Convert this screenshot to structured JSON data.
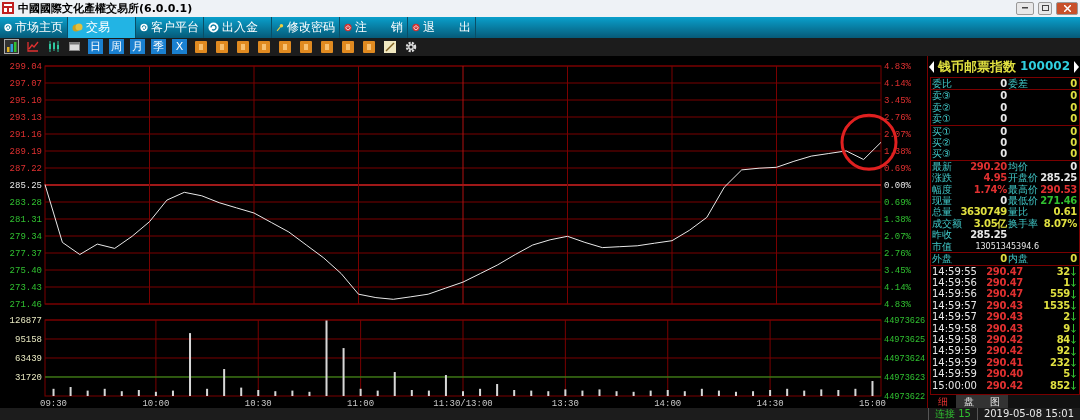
{
  "window": {
    "title": "中國國際文化產權交易所(6.0.0.1)"
  },
  "nav": {
    "items": [
      {
        "label": "市场主页",
        "kind": "refresh",
        "selected": false
      },
      {
        "label": "交易",
        "kind": "trade",
        "selected": true
      },
      {
        "label": "客户平台",
        "kind": "refresh",
        "selected": false
      },
      {
        "label": "出入金",
        "kind": "refresh",
        "selected": false
      },
      {
        "label": "修改密码",
        "kind": "key",
        "selected": false
      },
      {
        "label": "注　　销",
        "kind": "power",
        "selected": false
      },
      {
        "label": "退　　出",
        "kind": "power",
        "selected": false
      }
    ]
  },
  "toolbar": {
    "items": [
      {
        "kind": "bars",
        "selected": true
      },
      {
        "kind": "line",
        "selected": false
      },
      {
        "kind": "candle",
        "selected": false
      },
      {
        "kind": "window",
        "selected": false
      },
      {
        "kind": "period",
        "label": "日",
        "selected": false
      },
      {
        "kind": "period",
        "label": "周",
        "selected": false
      },
      {
        "kind": "period",
        "label": "月",
        "selected": false
      },
      {
        "kind": "period",
        "label": "季",
        "selected": false
      },
      {
        "kind": "period",
        "label": "X",
        "selected": false
      },
      {
        "kind": "minutes",
        "selected": false
      },
      {
        "kind": "minutes",
        "selected": false
      },
      {
        "kind": "minutes",
        "selected": false
      },
      {
        "kind": "minutes",
        "selected": false
      },
      {
        "kind": "minutes",
        "selected": false
      },
      {
        "kind": "minutes",
        "selected": false
      },
      {
        "kind": "minutes",
        "selected": false
      },
      {
        "kind": "minutes",
        "selected": false
      },
      {
        "kind": "minutes",
        "selected": false
      },
      {
        "kind": "draw",
        "selected": false
      },
      {
        "kind": "gear",
        "selected": false
      }
    ]
  },
  "price_chart": {
    "right_labels": [
      "4.83%",
      "4.14%",
      "3.45%",
      "2.76%",
      "2.07%",
      "1.38%",
      "0.69%",
      "0.00%",
      "0.69%",
      "1.38%",
      "2.07%",
      "2.76%",
      "3.45%",
      "4.14%",
      "4.83%"
    ],
    "highlight_circle": true,
    "chart_data": {
      "type": "line",
      "grid": true,
      "ref_lines": [
        {
          "axis": "y",
          "value": 285.25,
          "color": "#c02020"
        }
      ],
      "ylim": [
        271.46,
        299.04
      ],
      "yticks": [
        {
          "value": 299.04,
          "label": "299.04"
        },
        {
          "value": 297.07,
          "label": "297.07"
        },
        {
          "value": 295.1,
          "label": "295.10"
        },
        {
          "value": 293.13,
          "label": "293.13"
        },
        {
          "value": 291.16,
          "label": "291.16"
        },
        {
          "value": 289.19,
          "label": "289.19"
        },
        {
          "value": 287.22,
          "label": "287.22"
        },
        {
          "value": 285.25,
          "label": "285.25"
        },
        {
          "value": 283.28,
          "label": "283.28"
        },
        {
          "value": 281.31,
          "label": "281.31"
        },
        {
          "value": 279.34,
          "label": "279.34"
        },
        {
          "value": 277.37,
          "label": "277.37"
        },
        {
          "value": 275.4,
          "label": "275.40"
        },
        {
          "value": 273.43,
          "label": "273.43"
        },
        {
          "value": 271.46,
          "label": "271.46"
        }
      ],
      "categories": [
        null,
        null,
        null,
        null,
        null,
        null,
        null,
        null,
        null,
        null,
        null,
        null,
        null,
        null,
        null,
        null,
        null,
        null,
        null,
        null,
        null,
        null,
        null,
        null,
        null,
        null,
        null,
        null,
        null,
        null,
        null,
        null,
        null,
        null,
        null,
        null,
        null,
        null,
        null,
        null,
        null,
        null,
        null,
        null,
        null,
        null,
        null,
        null,
        null
      ],
      "series": [
        {
          "color": "#e8e8e8",
          "values": [
            285.3,
            278.6,
            277.2,
            278.4,
            277.9,
            279.3,
            281.0,
            283.5,
            284.4,
            284.0,
            283.2,
            282.6,
            282.0,
            280.9,
            279.8,
            278.3,
            276.8,
            275.0,
            272.6,
            272.2,
            272.0,
            272.3,
            272.6,
            273.3,
            274.0,
            275.0,
            276.0,
            277.2,
            278.3,
            278.9,
            279.3,
            278.6,
            278.0,
            278.1,
            278.2,
            278.5,
            278.8,
            280.0,
            281.5,
            285.0,
            287.0,
            287.2,
            287.3,
            288.0,
            288.6,
            288.9,
            289.2,
            288.2,
            290.2
          ]
        }
      ]
    }
  },
  "volume_chart": {
    "right_labels": [
      "44973626",
      "44973625",
      "44973624",
      "44973623",
      "44973622"
    ],
    "chart_data": {
      "type": "bar",
      "grid": true,
      "ref_lines": [
        {
          "axis": "y",
          "value": 31720,
          "color": "#20b020"
        }
      ],
      "ylim": [
        0,
        126877
      ],
      "yticks": [
        {
          "value": 126877,
          "label": "126877"
        },
        {
          "value": 95158,
          "label": "95158"
        },
        {
          "value": 63439,
          "label": "63439"
        },
        {
          "value": 31720,
          "label": "31720"
        }
      ],
      "categories": [
        "09:30",
        null,
        null,
        null,
        null,
        null,
        "10:00",
        null,
        null,
        null,
        null,
        null,
        "10:30",
        null,
        null,
        null,
        null,
        null,
        "11:00",
        null,
        null,
        null,
        null,
        null,
        "11:30/13:00",
        null,
        null,
        null,
        null,
        null,
        "13:30",
        null,
        null,
        null,
        null,
        null,
        "14:00",
        null,
        null,
        null,
        null,
        null,
        "14:30",
        null,
        null,
        null,
        null,
        null,
        "15:00"
      ],
      "series": [
        {
          "color": "#d8d8d8",
          "values": [
            12000,
            15000,
            9000,
            12000,
            8000,
            10000,
            7000,
            9000,
            105000,
            12000,
            45000,
            14000,
            10000,
            8000,
            9000,
            7000,
            126000,
            80000,
            12000,
            9000,
            40000,
            10000,
            9000,
            35000,
            8000,
            12000,
            20000,
            10000,
            9000,
            8000,
            11000,
            9000,
            11000,
            8000,
            7000,
            9000,
            10000,
            8000,
            12000,
            9000,
            7000,
            8000,
            10000,
            12000,
            9000,
            11000,
            10000,
            12000,
            25000
          ]
        }
      ]
    }
  },
  "quote": {
    "name": "钱币邮票指数",
    "code": "100002",
    "ratio": [
      {
        "label": "委比",
        "value": "0",
        "color": "#e8e8e8"
      },
      {
        "label": "委差",
        "value": "0",
        "color": "#e0e040"
      }
    ],
    "sell": [
      {
        "label": "卖③",
        "price": "0",
        "volume": "0"
      },
      {
        "label": "卖②",
        "price": "0",
        "volume": "0"
      },
      {
        "label": "卖①",
        "price": "0",
        "volume": "0"
      }
    ],
    "buy": [
      {
        "label": "买①",
        "price": "0",
        "volume": "0"
      },
      {
        "label": "买②",
        "price": "0",
        "volume": "0"
      },
      {
        "label": "买③",
        "price": "0",
        "volume": "0"
      }
    ],
    "stats": [
      [
        {
          "label": "最新",
          "value": "290.20",
          "color": "#e03030"
        },
        {
          "label": "均价",
          "value": "0",
          "color": "#e8e8e8"
        }
      ],
      [
        {
          "label": "涨跌",
          "value": "4.95",
          "color": "#e03030"
        },
        {
          "label": "开盘价",
          "value": "285.25",
          "color": "#e8e8e8"
        }
      ],
      [
        {
          "label": "幅度",
          "value": "1.74%",
          "color": "#e03030"
        },
        {
          "label": "最高价",
          "value": "290.53",
          "color": "#e03030"
        }
      ],
      [
        {
          "label": "现量",
          "value": "0",
          "color": "#e8e8e8"
        },
        {
          "label": "最低价",
          "value": "271.46",
          "color": "#30c030"
        }
      ],
      [
        {
          "label": "总量",
          "value": "3630749",
          "color": "#e0e040"
        },
        {
          "label": "量比",
          "value": "0.61",
          "color": "#e0e040"
        }
      ],
      [
        {
          "label": "成交额",
          "value": "3.05亿",
          "color": "#e0e040"
        },
        {
          "label": "换手率",
          "value": "8.07%",
          "color": "#e0e040"
        }
      ],
      [
        {
          "label": "昨收",
          "value": "285.25",
          "color": "#e8e8e8"
        }
      ],
      [
        {
          "label": "市值",
          "value": "13051345394.6",
          "color": "#e8e8e8",
          "kind": "small"
        }
      ]
    ],
    "outer_inner": [
      {
        "label": "外盘",
        "value": "0"
      },
      {
        "label": "内盘",
        "value": "0"
      }
    ]
  },
  "trades": [
    {
      "time": "14:59:55",
      "price": "290.47",
      "volume": "32",
      "kind": "down"
    },
    {
      "time": "14:59:56",
      "price": "290.47",
      "volume": "1",
      "kind": "down"
    },
    {
      "time": "14:59:56",
      "price": "290.47",
      "volume": "559",
      "kind": "down"
    },
    {
      "time": "14:59:57",
      "price": "290.43",
      "volume": "1535",
      "kind": "down"
    },
    {
      "time": "14:59:57",
      "price": "290.43",
      "volume": "2",
      "kind": "down"
    },
    {
      "time": "14:59:58",
      "price": "290.43",
      "volume": "9",
      "kind": "down"
    },
    {
      "time": "14:59:58",
      "price": "290.42",
      "volume": "84",
      "kind": "down"
    },
    {
      "time": "14:59:59",
      "price": "290.42",
      "volume": "92",
      "kind": "down"
    },
    {
      "time": "14:59:59",
      "price": "290.41",
      "volume": "232",
      "kind": "down"
    },
    {
      "time": "14:59:59",
      "price": "290.40",
      "volume": "5",
      "kind": "down"
    },
    {
      "time": "15:00:00",
      "price": "290.42",
      "volume": "852",
      "kind": "down"
    }
  ],
  "panel_tabs": [
    {
      "label": "细",
      "selected": true
    },
    {
      "label": "盘",
      "selected": false
    },
    {
      "label": "图",
      "selected": false
    }
  ],
  "status_bar": {
    "connection_label": "连接",
    "connection_count": "15",
    "datetime": "2019-05-08 15:01"
  }
}
